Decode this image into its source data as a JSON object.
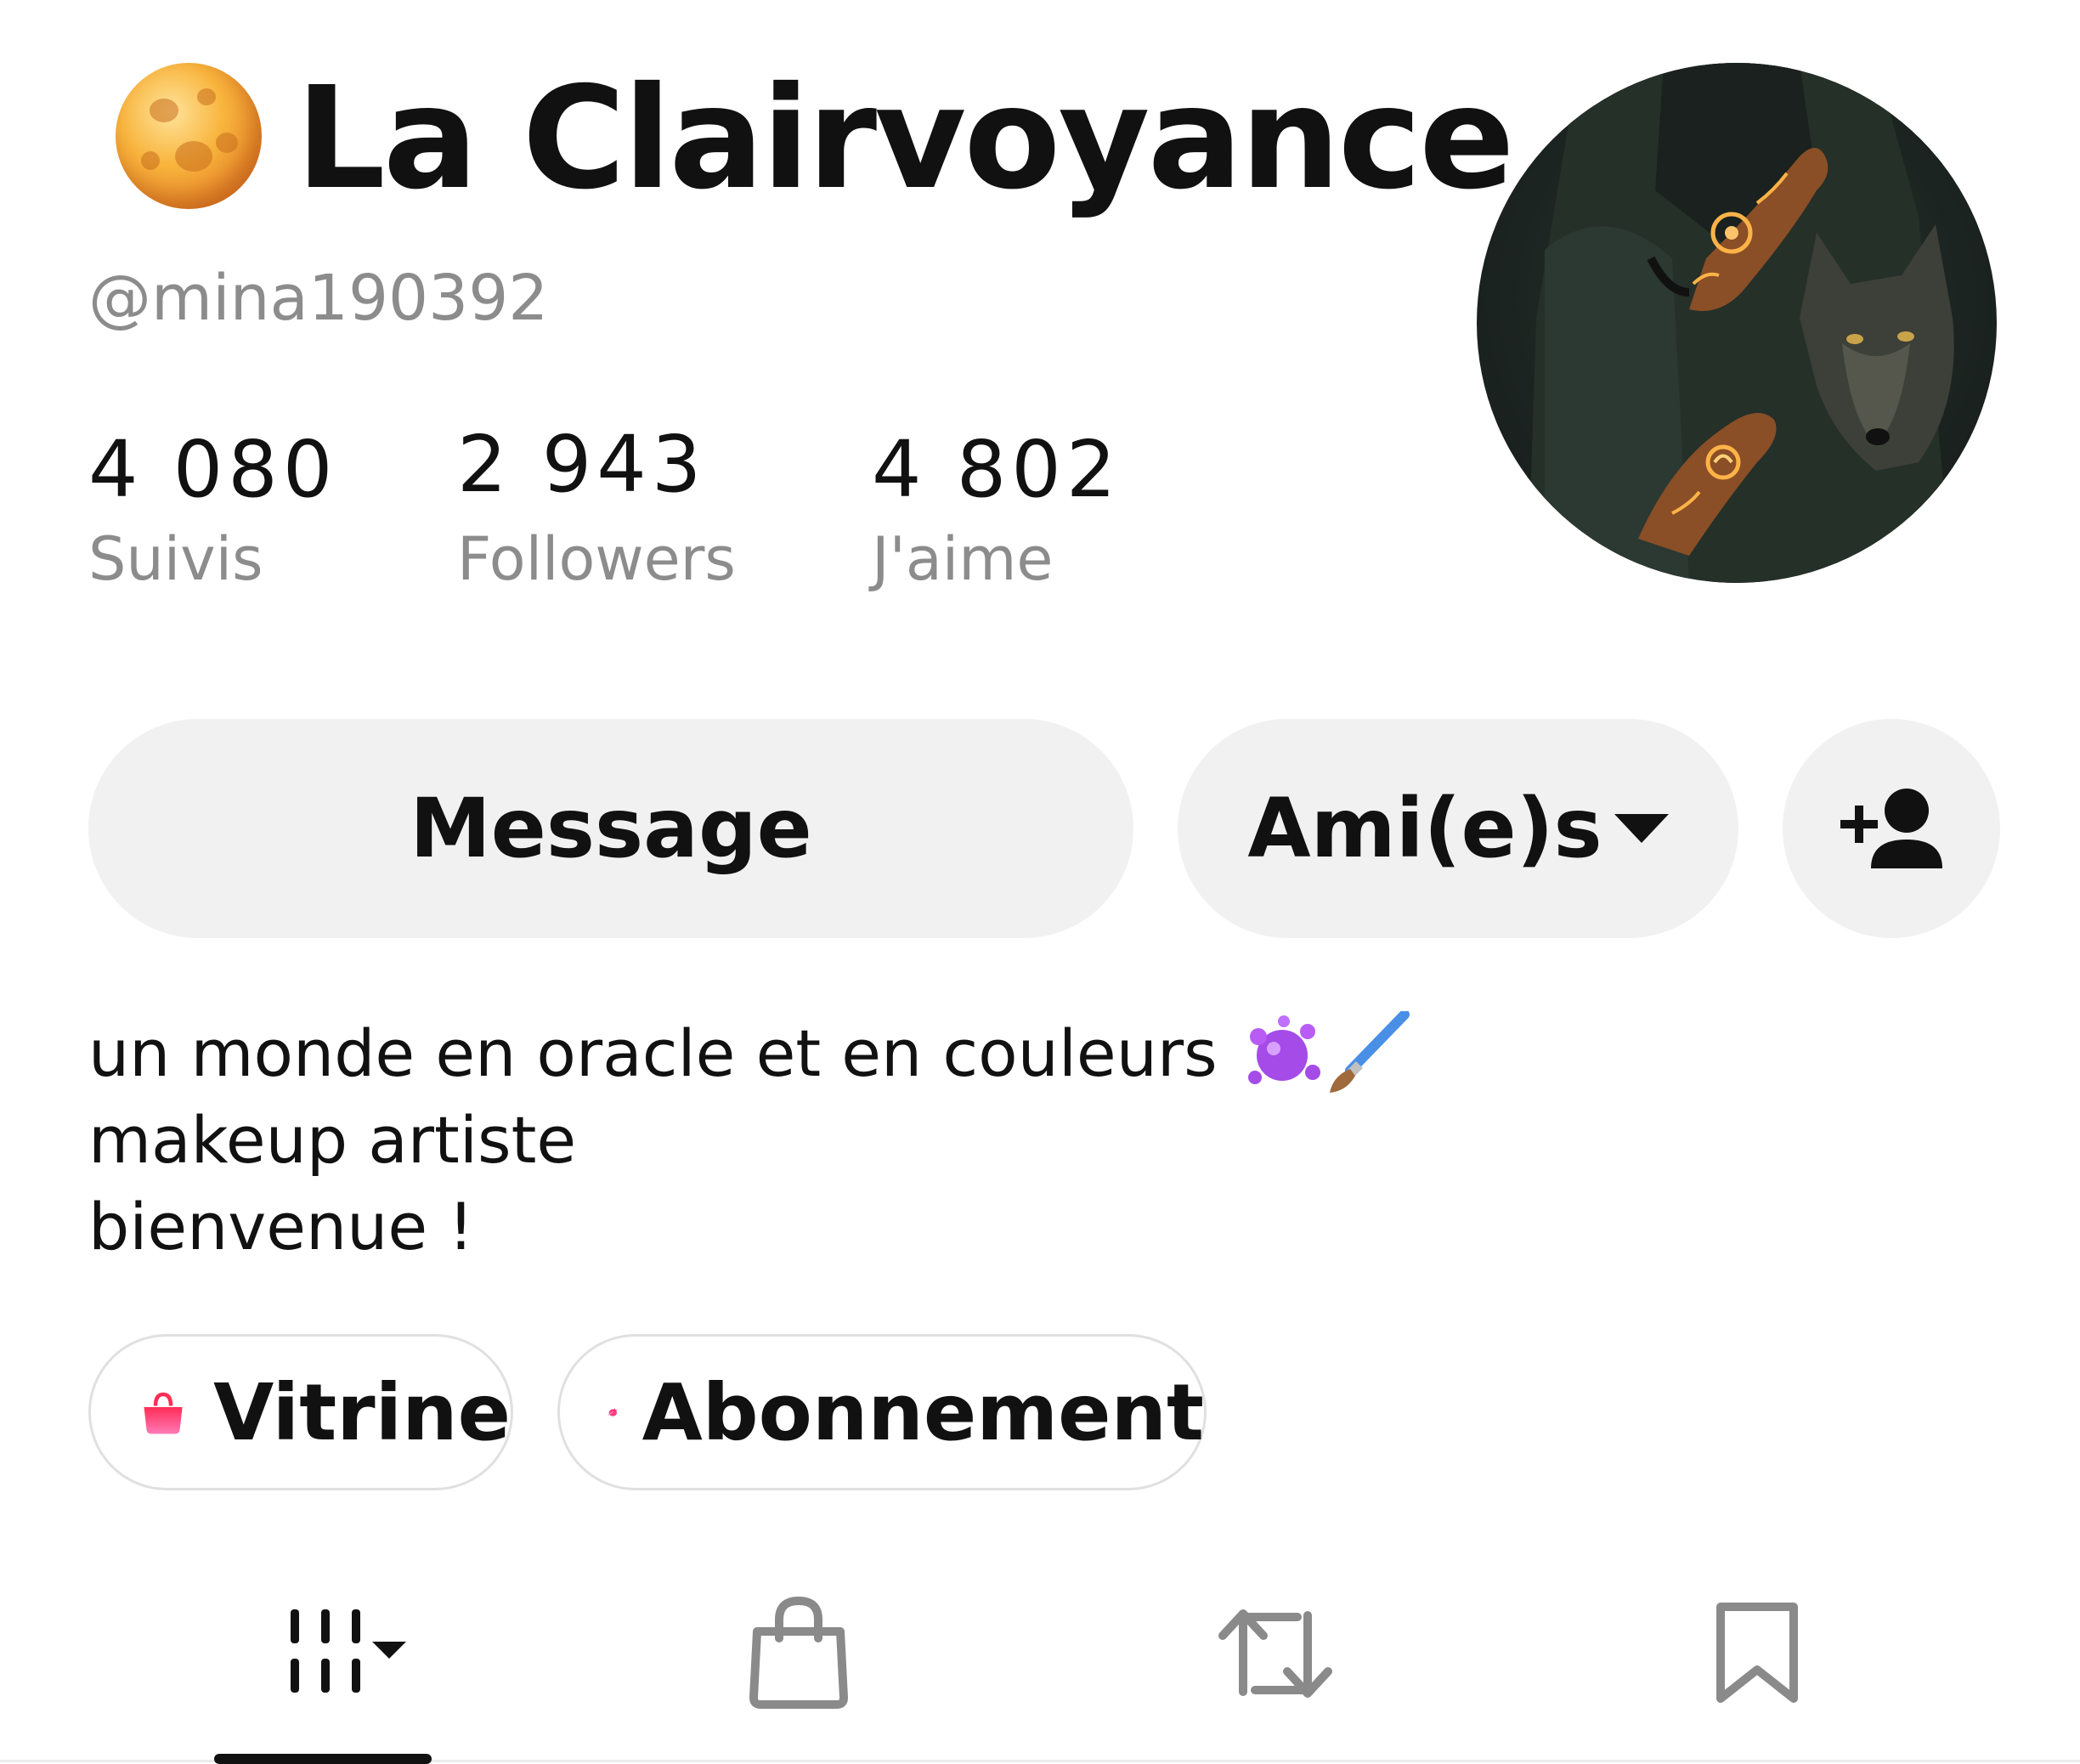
{
  "profile": {
    "name": "La Clairvoyance ...",
    "username": "@mina190392",
    "name_icon": "full-moon-emoji"
  },
  "stats": [
    {
      "value": "4 080",
      "label": "Suivis"
    },
    {
      "value": "2 943",
      "label": "Followers"
    },
    {
      "value": "4 802",
      "label": "J'aime"
    }
  ],
  "actions": {
    "message_label": "Message",
    "friends_label": "Ami(e)s",
    "friends_icon": "caret-down-icon",
    "add_friend_icon": "add-person-icon"
  },
  "bio": {
    "line1": "un monde en oracle et en couleurs",
    "line1_icons": [
      "paint-splash-emoji",
      "paintbrush-emoji"
    ],
    "line2": "makeup artiste",
    "line3": "bienvenue !"
  },
  "chips": {
    "vitrine_label": "Vitrine",
    "vitrine_icon": "shopping-bag-icon",
    "abonnement_label": "Abonnement",
    "abonnement_icon": "planet-star-icon"
  },
  "tabs": [
    {
      "icon": "videos-grid-icon",
      "active": true
    },
    {
      "icon": "shopping-bag-icon",
      "active": false
    },
    {
      "icon": "repost-icon",
      "active": false
    },
    {
      "icon": "bookmark-icon",
      "active": false
    }
  ],
  "colors": {
    "text_primary": "#111111",
    "text_secondary": "#8c8c8c",
    "button_bg": "#f1f1f1",
    "chip_border": "#e0e0e0",
    "accent_pink": "#ff3b7f"
  }
}
